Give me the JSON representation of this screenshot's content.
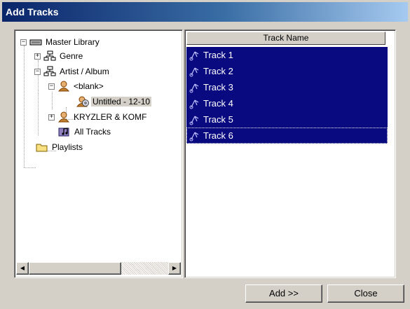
{
  "window": {
    "title": "Add Tracks"
  },
  "tree": {
    "nodes": [
      {
        "label": "Master Library",
        "icon": "drive-icon",
        "expander": "−"
      },
      {
        "label": "Genre",
        "icon": "hierarchy-icon",
        "expander": "+"
      },
      {
        "label": "Artist / Album",
        "icon": "hierarchy-icon",
        "expander": "−"
      },
      {
        "label": "<blank>",
        "icon": "artist-icon",
        "expander": "−"
      },
      {
        "label": "Untitled - 12-10",
        "icon": "album-disc-icon",
        "selected": true
      },
      {
        "label": "KRYZLER & KOMF",
        "icon": "artist-icon",
        "expander": "+"
      },
      {
        "label": "All Tracks",
        "icon": "all-tracks-icon"
      },
      {
        "label": "Playlists",
        "icon": "folder-icon"
      }
    ]
  },
  "list": {
    "column_header": "Track Name",
    "tracks": [
      "Track 1",
      "Track 2",
      "Track 3",
      "Track 4",
      "Track 5",
      "Track 6"
    ]
  },
  "buttons": {
    "add": "Add >>",
    "close": "Close"
  },
  "colors": {
    "selection": "#0a0a80",
    "face": "#d4d0c8",
    "title_start": "#0a246a"
  }
}
